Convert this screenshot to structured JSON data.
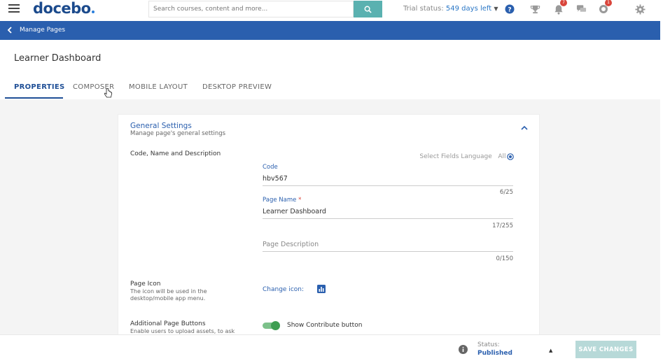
{
  "topbar": {
    "logo": "docebo",
    "search_placeholder": "Search courses, content and more...",
    "trial_label": "Trial status:",
    "trial_days": "549 days left",
    "notifications_badge": "7",
    "gift_badge": "1"
  },
  "breadcrumb": {
    "label": "Manage Pages"
  },
  "header": {
    "title": "Learner Dashboard",
    "tabs": [
      {
        "label": "PROPERTIES"
      },
      {
        "label": "COMPOSER"
      },
      {
        "label": "MOBILE LAYOUT"
      },
      {
        "label": "DESKTOP PREVIEW"
      }
    ]
  },
  "general": {
    "title": "General Settings",
    "subtitle": "Manage page's general settings",
    "group_code_name": "Code, Name and Description",
    "lang_label": "Select Fields Language",
    "lang_value": "All",
    "code_label": "Code",
    "code_value": "hbv567",
    "code_counter": "6/25",
    "name_label": "Page Name",
    "name_required": "*",
    "name_value": "Learner Dashboard",
    "name_counter": "17/255",
    "desc_placeholder": "Page Description",
    "desc_counter": "0/150",
    "icon_group_label": "Page Icon",
    "icon_group_desc": "The icon will be used in the desktop/mobile app menu.",
    "change_icon_label": "Change icon:",
    "buttons_group_label": "Additional Page Buttons",
    "buttons_group_desc": "Enable users to upload assets, to ask",
    "contribute_label": "Show Contribute button",
    "contribute_enabled": true
  },
  "footer": {
    "status_label": "Status:",
    "status_value": "Published",
    "save_label": "SAVE CHANGES"
  },
  "colors": {
    "brand": "#2a5fae",
    "accent_teal": "#5ab1b0",
    "toggle_on": "#3e9e52",
    "badge": "#d9453b"
  }
}
